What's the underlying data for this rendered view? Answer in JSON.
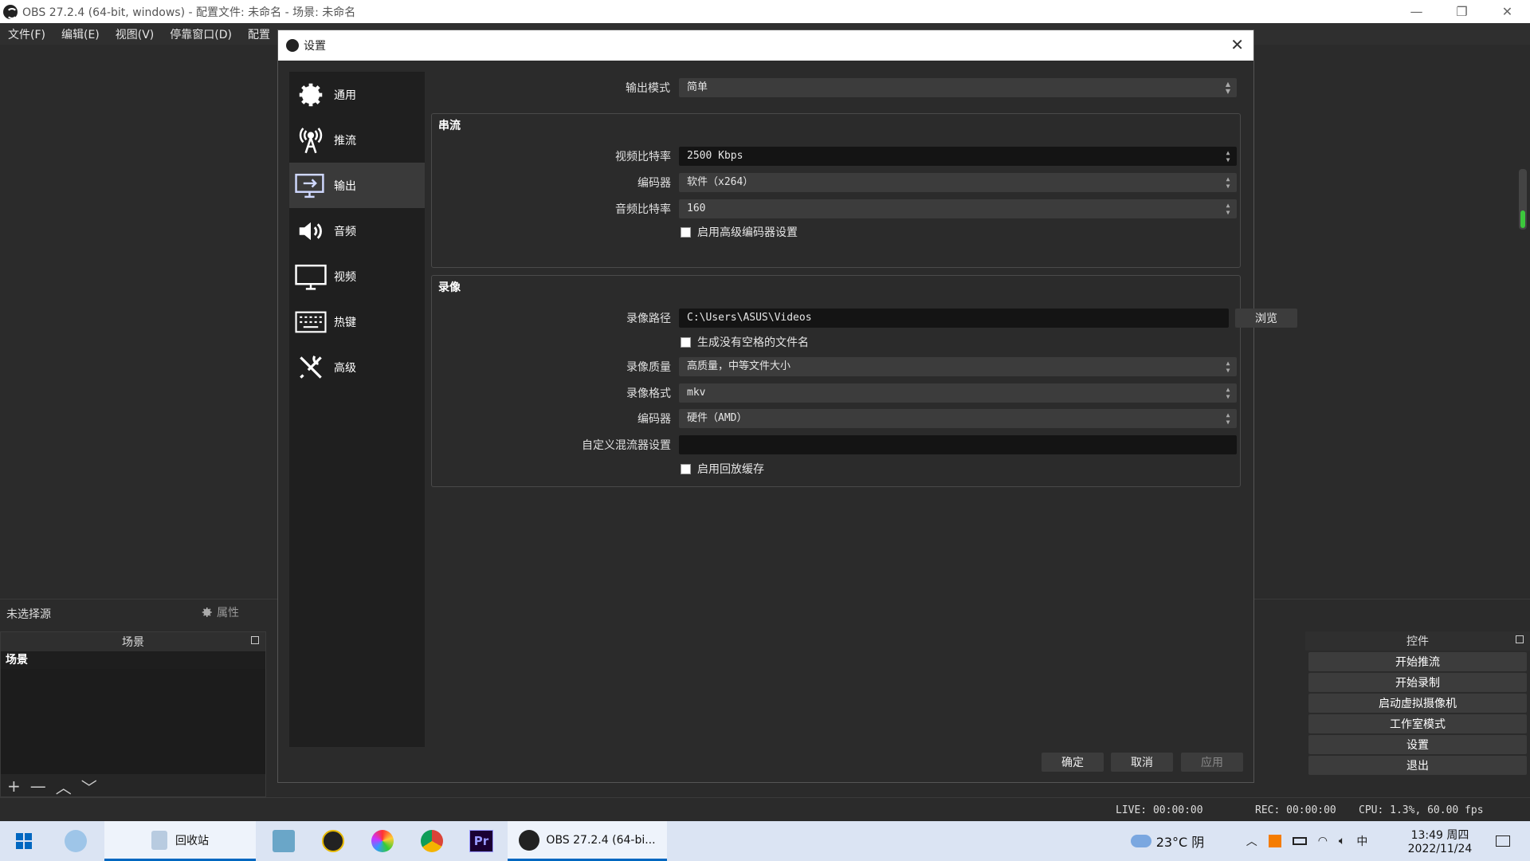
{
  "window": {
    "title": "OBS 27.2.4 (64-bit, windows) - 配置文件: 未命名 - 场景: 未命名",
    "min": "—",
    "max": "❐",
    "close": "✕"
  },
  "menu": [
    "文件(F)",
    "编辑(E)",
    "视图(V)",
    "停靠窗口(D)",
    "配置"
  ],
  "main": {
    "no_source": "未选择源",
    "properties": "属性",
    "scenes_header": "场景",
    "scene_item": "场景",
    "controls_header": "控件",
    "controls": [
      "开始推流",
      "开始录制",
      "启动虚拟摄像机",
      "工作室模式",
      "设置",
      "退出"
    ],
    "status": {
      "live": "LIVE: 00:00:00",
      "rec": "REC: 00:00:00",
      "cpu": "CPU: 1.3%, 60.00 fps"
    }
  },
  "dialog": {
    "title": "设置",
    "sidebar": [
      {
        "label": "通用",
        "icon": "gear-icon"
      },
      {
        "label": "推流",
        "icon": "antenna-icon"
      },
      {
        "label": "输出",
        "icon": "output-monitor-icon"
      },
      {
        "label": "音频",
        "icon": "speaker-icon"
      },
      {
        "label": "视频",
        "icon": "monitor-icon"
      },
      {
        "label": "热键",
        "icon": "keyboard-icon"
      },
      {
        "label": "高级",
        "icon": "tools-icon"
      }
    ],
    "active_index": 2,
    "output_mode_label": "输出模式",
    "output_mode_value": "简单",
    "streaming": {
      "title": "串流",
      "video_bitrate_label": "视频比特率",
      "video_bitrate_value": "2500 Kbps",
      "encoder_label": "编码器",
      "encoder_value": "软件（x264）",
      "audio_bitrate_label": "音频比特率",
      "audio_bitrate_value": "160",
      "advanced_encoder_label": "启用高级编码器设置"
    },
    "recording": {
      "title": "录像",
      "path_label": "录像路径",
      "path_value": "C:\\Users\\ASUS\\Videos",
      "browse": "浏览",
      "no_space_label": "生成没有空格的文件名",
      "quality_label": "录像质量",
      "quality_value": "高质量，中等文件大小",
      "format_label": "录像格式",
      "format_value": "mkv",
      "encoder_label": "编码器",
      "encoder_value": "硬件（AMD）",
      "muxer_label": "自定义混流器设置",
      "muxer_value": "",
      "replay_label": "启用回放缓存"
    },
    "buttons": {
      "ok": "确定",
      "cancel": "取消",
      "apply": "应用"
    }
  },
  "taskbar": {
    "recycle": "回收站",
    "obs": "OBS 27.2.4 (64-bi...",
    "weather": "23°C 阴",
    "time": "13:49 周四",
    "date": "2022/11/24",
    "ime": "中"
  },
  "colors": {
    "accent": "#0067c0",
    "meter": "#3cc83c"
  }
}
